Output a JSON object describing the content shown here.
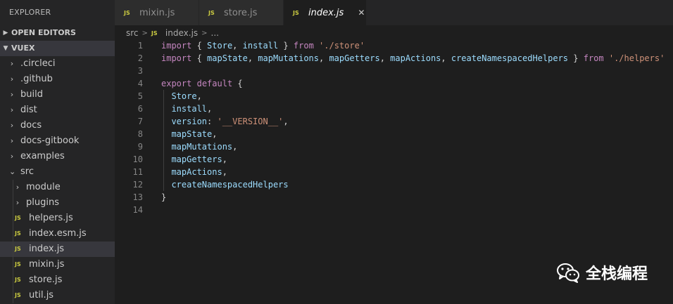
{
  "sidebar": {
    "title": "EXPLORER",
    "open_editors": "OPEN EDITORS",
    "project": "VUEX",
    "items": [
      {
        "label": ".circleci",
        "type": "folder",
        "level": 1
      },
      {
        "label": ".github",
        "type": "folder",
        "level": 1
      },
      {
        "label": "build",
        "type": "folder",
        "level": 1
      },
      {
        "label": "dist",
        "type": "folder",
        "level": 1
      },
      {
        "label": "docs",
        "type": "folder",
        "level": 1
      },
      {
        "label": "docs-gitbook",
        "type": "folder",
        "level": 1
      },
      {
        "label": "examples",
        "type": "folder",
        "level": 1
      },
      {
        "label": "src",
        "type": "folder-open",
        "level": 1
      },
      {
        "label": "module",
        "type": "folder",
        "level": 2
      },
      {
        "label": "plugins",
        "type": "folder",
        "level": 2
      },
      {
        "label": "helpers.js",
        "type": "js",
        "level": 2
      },
      {
        "label": "index.esm.js",
        "type": "js",
        "level": 2
      },
      {
        "label": "index.js",
        "type": "js",
        "level": 2,
        "selected": true
      },
      {
        "label": "mixin.js",
        "type": "js",
        "level": 2
      },
      {
        "label": "store.js",
        "type": "js",
        "level": 2
      },
      {
        "label": "util.js",
        "type": "js",
        "level": 2
      }
    ]
  },
  "tabs": [
    {
      "label": "mixin.js",
      "active": false
    },
    {
      "label": "store.js",
      "active": false
    },
    {
      "label": "index.js",
      "active": true
    }
  ],
  "js_badge": "JS",
  "close_glyph": "✕",
  "breadcrumb": {
    "folder": "src",
    "file": "index.js",
    "more": "..."
  },
  "code": [
    {
      "n": "1",
      "tokens": [
        [
          "k",
          "import"
        ],
        [
          "p",
          " { "
        ],
        [
          "v",
          "Store"
        ],
        [
          "p",
          ", "
        ],
        [
          "v",
          "install"
        ],
        [
          "p",
          " } "
        ],
        [
          "k",
          "from"
        ],
        [
          "p",
          " "
        ],
        [
          "s",
          "'./store'"
        ]
      ]
    },
    {
      "n": "2",
      "tokens": [
        [
          "k",
          "import"
        ],
        [
          "p",
          " { "
        ],
        [
          "v",
          "mapState"
        ],
        [
          "p",
          ", "
        ],
        [
          "v",
          "mapMutations"
        ],
        [
          "p",
          ", "
        ],
        [
          "v",
          "mapGetters"
        ],
        [
          "p",
          ", "
        ],
        [
          "v",
          "mapActions"
        ],
        [
          "p",
          ", "
        ],
        [
          "v",
          "createNamespacedHelpers"
        ],
        [
          "p",
          " } "
        ],
        [
          "k",
          "from"
        ],
        [
          "p",
          " "
        ],
        [
          "s",
          "'./helpers'"
        ]
      ]
    },
    {
      "n": "3",
      "tokens": []
    },
    {
      "n": "4",
      "tokens": [
        [
          "k",
          "export"
        ],
        [
          "p",
          " "
        ],
        [
          "k",
          "default"
        ],
        [
          "p",
          " {"
        ]
      ]
    },
    {
      "n": "5",
      "tokens": [
        [
          "p",
          "  "
        ],
        [
          "v",
          "Store"
        ],
        [
          "p",
          ","
        ]
      ],
      "guide": true
    },
    {
      "n": "6",
      "tokens": [
        [
          "p",
          "  "
        ],
        [
          "v",
          "install"
        ],
        [
          "p",
          ","
        ]
      ],
      "guide": true
    },
    {
      "n": "7",
      "tokens": [
        [
          "p",
          "  "
        ],
        [
          "v",
          "version"
        ],
        [
          "p",
          ": "
        ],
        [
          "s",
          "'__VERSION__'"
        ],
        [
          "p",
          ","
        ]
      ],
      "guide": true
    },
    {
      "n": "8",
      "tokens": [
        [
          "p",
          "  "
        ],
        [
          "v",
          "mapState"
        ],
        [
          "p",
          ","
        ]
      ],
      "guide": true
    },
    {
      "n": "9",
      "tokens": [
        [
          "p",
          "  "
        ],
        [
          "v",
          "mapMutations"
        ],
        [
          "p",
          ","
        ]
      ],
      "guide": true
    },
    {
      "n": "10",
      "tokens": [
        [
          "p",
          "  "
        ],
        [
          "v",
          "mapGetters"
        ],
        [
          "p",
          ","
        ]
      ],
      "guide": true
    },
    {
      "n": "11",
      "tokens": [
        [
          "p",
          "  "
        ],
        [
          "v",
          "mapActions"
        ],
        [
          "p",
          ","
        ]
      ],
      "guide": true
    },
    {
      "n": "12",
      "tokens": [
        [
          "p",
          "  "
        ],
        [
          "v",
          "createNamespacedHelpers"
        ]
      ],
      "guide": true
    },
    {
      "n": "13",
      "tokens": [
        [
          "p",
          "}"
        ]
      ]
    },
    {
      "n": "14",
      "tokens": []
    }
  ],
  "watermark": {
    "text": "全栈编程",
    "icon": "wechat-icon"
  }
}
